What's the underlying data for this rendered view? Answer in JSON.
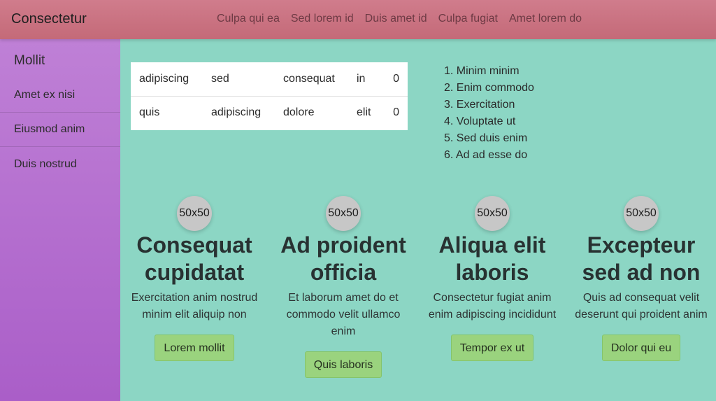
{
  "header": {
    "brand": "Consectetur",
    "nav": [
      "Culpa qui ea",
      "Sed lorem id",
      "Duis amet id",
      "Culpa fugiat",
      "Amet lorem do"
    ]
  },
  "sidebar": {
    "title": "Mollit",
    "items": [
      "Amet ex nisi",
      "Eiusmod anim",
      "Duis nostrud"
    ]
  },
  "table": {
    "rows": [
      [
        "adipiscing",
        "sed",
        "consequat",
        "in",
        "0"
      ],
      [
        "quis",
        "adipiscing",
        "dolore",
        "elit",
        "0"
      ]
    ]
  },
  "ordered_list": [
    "1. Minim minim",
    "2. Enim commodo",
    "3. Exercitation",
    "4. Voluptate ut",
    "5. Sed duis enim",
    "6. Ad ad esse do"
  ],
  "cards": [
    {
      "avatar": "50x50",
      "title": "Consequat cupidatat",
      "text": "Exercitation anim nostrud minim elit aliquip non",
      "button": "Lorem mollit"
    },
    {
      "avatar": "50x50",
      "title": "Ad proident officia",
      "text": "Et laborum amet do et commodo velit ullamco enim",
      "button": "Quis laboris"
    },
    {
      "avatar": "50x50",
      "title": "Aliqua elit laboris",
      "text": "Consectetur fugiat anim enim adipiscing incididunt",
      "button": "Tempor ex ut"
    },
    {
      "avatar": "50x50",
      "title": "Excepteur sed ad non",
      "text": "Quis ad consequat velit deserunt qui proident anim",
      "button": "Dolor qui eu"
    }
  ]
}
